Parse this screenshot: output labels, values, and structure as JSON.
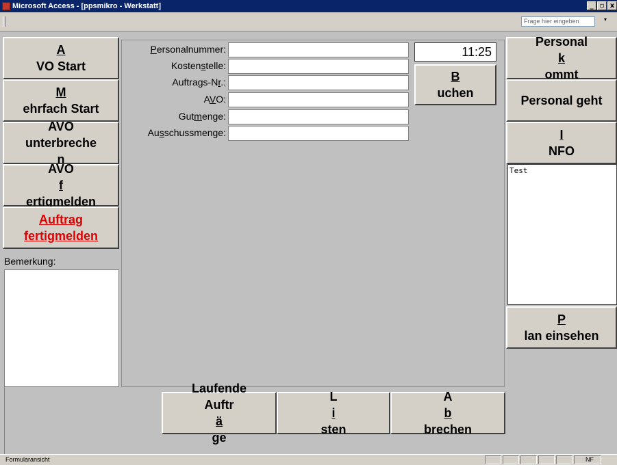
{
  "window": {
    "title": "Microsoft Access - [ppsmikro - Werkstatt]",
    "minimize_glyph": "_",
    "restore_glyph": "▫",
    "close_glyph": "x"
  },
  "toolbar": {
    "help_placeholder": "Frage hier eingeben",
    "help_dropdown_glyph": "▾"
  },
  "left_buttons": {
    "avo_start": {
      "pre": "",
      "key": "A",
      "post": "VO Start"
    },
    "mehrfach_start": {
      "pre": "",
      "key": "M",
      "post": "ehrfach Start"
    },
    "avo_unterbrechen": {
      "line1": "AVO",
      "pre": "unterbreche",
      "key": "n",
      "post": ""
    },
    "avo_fertigmelden": {
      "line1": "AVO",
      "pre": "",
      "key": "f",
      "post": "ertigmelden"
    },
    "auftrag_fertigmelden": {
      "line1": "Auftrag ",
      "line2": "fertigmelden"
    }
  },
  "remark": {
    "label": "Bemerkung:"
  },
  "form": {
    "fields": [
      {
        "pre": "",
        "key": "P",
        "post": "ersonalnummer:"
      },
      {
        "pre": "Kosten",
        "key": "s",
        "post": "telle:"
      },
      {
        "pre": "Auftrags-N",
        "key": "r",
        "post": ".:"
      },
      {
        "pre": "A",
        "key": "V",
        "post": "O:"
      },
      {
        "pre": "Gut",
        "key": "m",
        "post": "enge:"
      },
      {
        "pre": "Au",
        "key": "s",
        "post": "schussmenge:"
      }
    ],
    "clock": "11:25",
    "buchen": {
      "pre": "",
      "key": "B",
      "post": "uchen"
    }
  },
  "right_buttons": {
    "personal_kommt": {
      "line1": "Personal",
      "pre": "",
      "key": "k",
      "post": "ommt"
    },
    "personal_geht": {
      "label": "Personal geht"
    },
    "info": {
      "pre": "",
      "key": "I",
      "post": "NFO"
    },
    "info_text": "Test",
    "plan_einsehen": {
      "pre": "",
      "key": "P",
      "post": "lan einsehen"
    }
  },
  "bottom_buttons": {
    "laufende": {
      "line1": "Laufende",
      "pre": "Auftr",
      "key": "ä",
      "post": "ge"
    },
    "listen": {
      "pre": "L",
      "key": "i",
      "post": "sten"
    },
    "abbrechen": {
      "pre": "A",
      "key": "b",
      "post": "brechen"
    }
  },
  "status": {
    "text": "Formularansicht",
    "nf": "NF"
  }
}
